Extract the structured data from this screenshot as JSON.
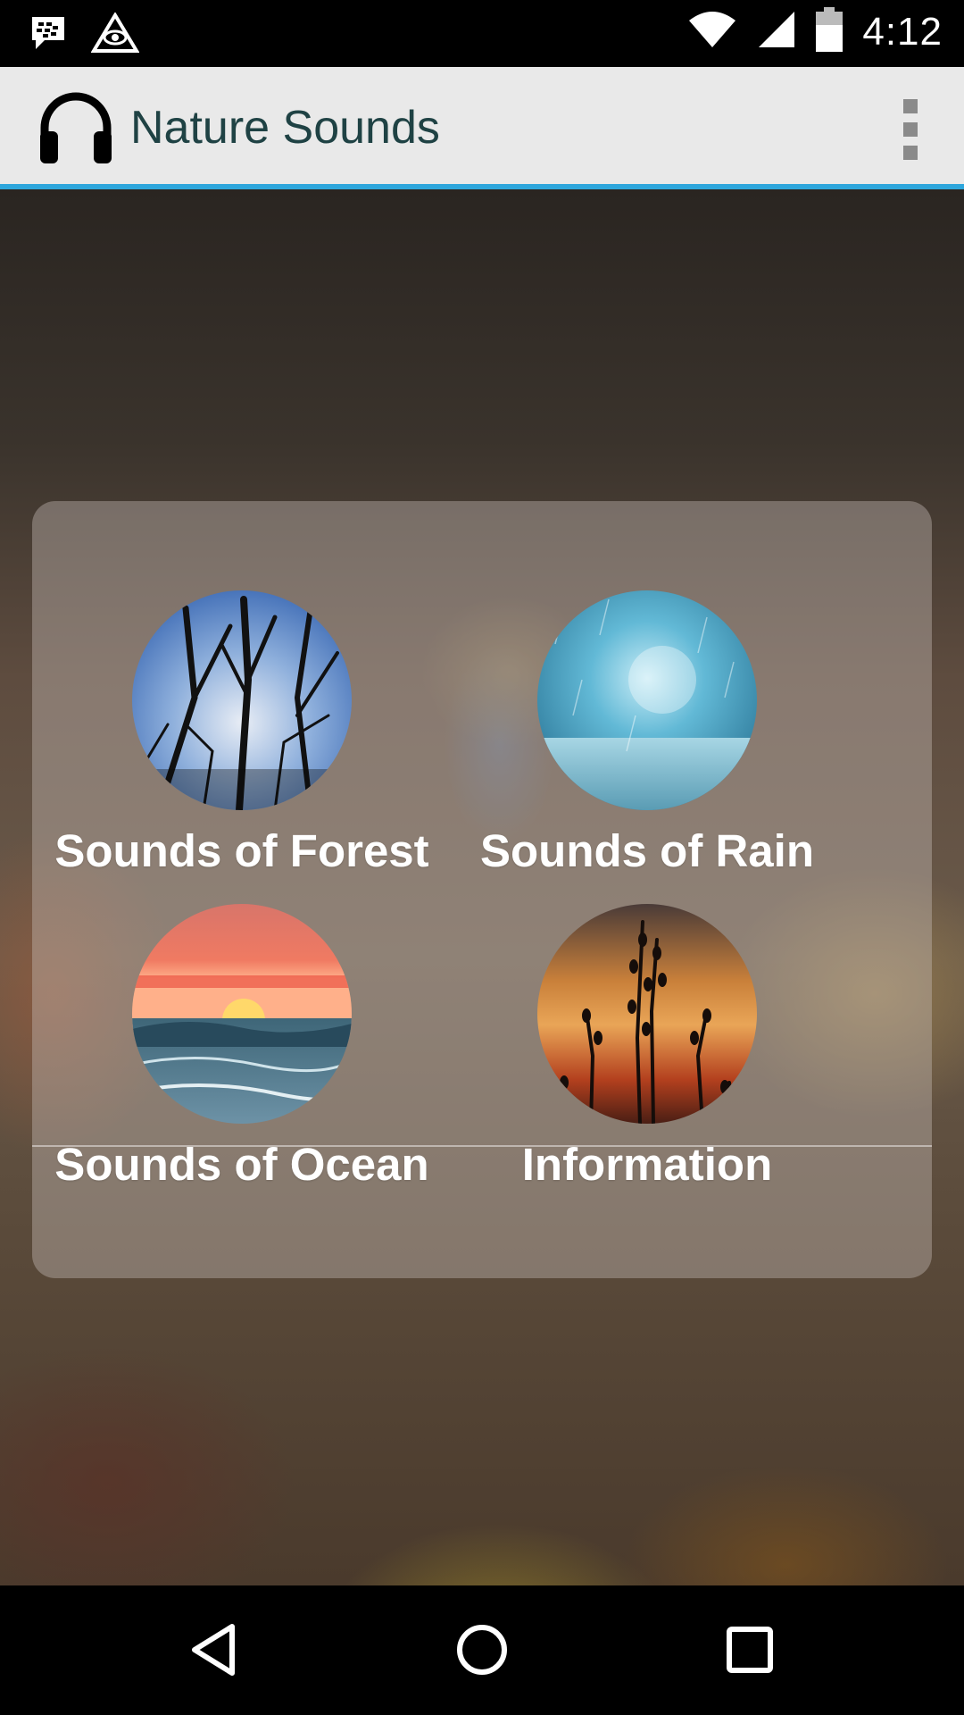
{
  "status_bar": {
    "time": "4:12",
    "icons": [
      "bbm-icon",
      "eye-triangle-icon",
      "wifi-icon",
      "signal-icon",
      "battery-icon"
    ]
  },
  "app_bar": {
    "title": "Nature Sounds",
    "logo_icon": "headphones-icon",
    "menu_icon": "overflow-menu-icon",
    "accent_color": "#2ea6dc"
  },
  "menu": {
    "items": [
      {
        "label": "Sounds of Forest",
        "image": "forest-trees-image"
      },
      {
        "label": "Sounds of Rain",
        "image": "rain-image"
      },
      {
        "label": "Sounds of Ocean",
        "image": "ocean-sunset-image"
      },
      {
        "label": "Information",
        "image": "plants-sunset-image"
      }
    ]
  },
  "nav_bar": {
    "icons": [
      "back-icon",
      "home-icon",
      "recents-icon"
    ]
  }
}
